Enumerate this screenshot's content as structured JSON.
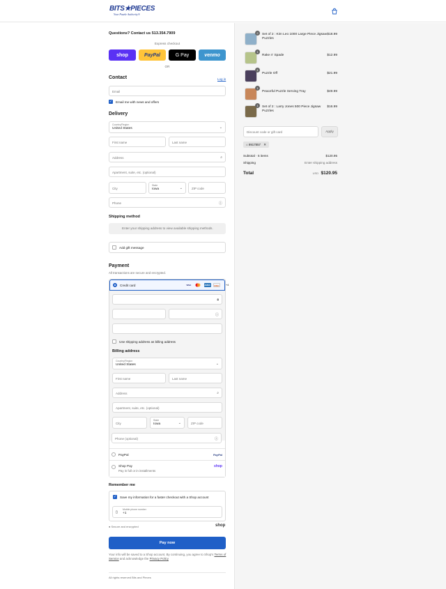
{
  "header": {
    "brand": "BITS★PIECES",
    "tagline": "Your Puzzle Authority®"
  },
  "left": {
    "questions": "Questions? Contact us 513.354.7909",
    "express_label": "Express checkout",
    "express": {
      "shop": "shop",
      "paypal": "PayPal",
      "gpay": "G Pay",
      "venmo": "venmo"
    },
    "or": "OR",
    "contact_title": "Contact",
    "login": "Log in",
    "email_ph": "Email",
    "email_news": "Email me with news and offers",
    "delivery_title": "Delivery",
    "country_label": "Country/Region",
    "country_val": "United States",
    "first_ph": "First name",
    "last_ph": "Last name",
    "address_ph": "Address",
    "apt_ph": "Apartment, suite, etc. (optional)",
    "city_ph": "City",
    "state_label": "State",
    "state_val": "Iowa",
    "zip_ph": "ZIP code",
    "phone_ph": "Phone",
    "ship_title": "Shipping method",
    "ship_msg": "Enter your shipping address to view available shipping methods.",
    "gift": "Add gift message",
    "payment_title": "Payment",
    "payment_sub": "All transactions are secure and encrypted.",
    "credit_card": "Credit card",
    "card_more": "+4",
    "use_ship": "Use shipping address as billing address",
    "billing_title": "Billing address",
    "b_first_ph": "First name",
    "b_last_ph": "Last name",
    "b_address_ph": "Address",
    "b_apt_ph": "Apartment, suite, etc. (optional)",
    "b_city_ph": "City",
    "b_state_label": "State",
    "b_state_val": "Iowa",
    "b_zip_ph": "ZIP code",
    "b_phone_ph": "Phone (optional)",
    "paypal": "PayPal",
    "paypal_logo": "PayPal",
    "shop_pay": "Shop Pay",
    "shop_pay_sub": "Pay in full or in installments",
    "shop_logo": "shop",
    "remember_title": "Remember me",
    "save_info": "Save my information for a faster checkout with a Shop account",
    "mobile_label": "Mobile phone number",
    "mobile_val": "+1",
    "secure": "Secure and encrypted",
    "shop_word": "shop",
    "pay_now": "Pay now",
    "legal_1": "Your info will be saved to a Shop account. By continuing, you agree to Shop's",
    "terms": "Terms of Service",
    "legal_2": "and acknowledge the",
    "privacy": "Privacy Policy",
    "footer": "All rights reserved Bits and Pieces"
  },
  "cart": {
    "items": [
      {
        "qty": "2",
        "name": "Set of 2 : Kim Leo 1000 Large Piece Jigsaw Puzzles",
        "price": "$18.99"
      },
      {
        "qty": "1",
        "name": "Rake n' Spade",
        "price": "$12.99"
      },
      {
        "qty": "1",
        "name": "Puzzle Off",
        "price": "$21.99"
      },
      {
        "qty": "1",
        "name": "Peaceful Puzzle Serving Tray",
        "price": "$49.99"
      },
      {
        "qty": "1",
        "name": "Set of 2 : Larry Jones 500 Piece Jigsaw Puzzles",
        "price": "$16.99"
      }
    ],
    "discount_ph": "Discount code or gift card",
    "apply": "Apply",
    "code": "9917857",
    "subtotal_label": "Subtotal · 5 items",
    "subtotal": "$120.95",
    "shipping_label": "Shipping",
    "shipping_val": "Enter shipping address",
    "total_label": "Total",
    "currency": "USD",
    "total": "$120.95"
  }
}
